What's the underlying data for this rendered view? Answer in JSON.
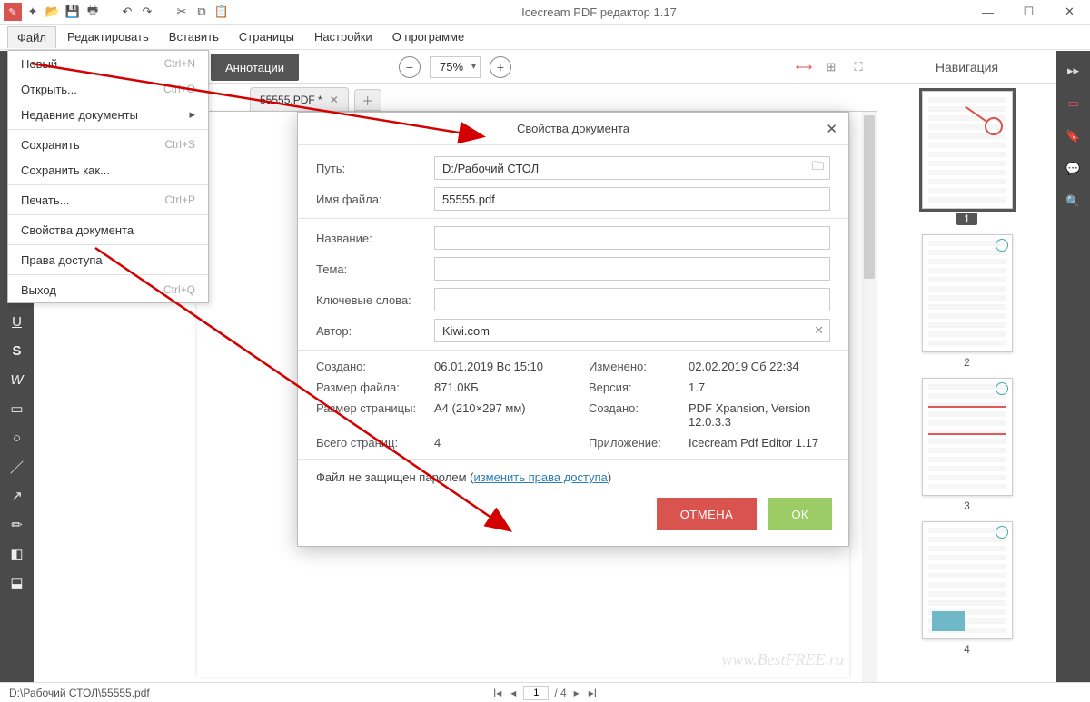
{
  "titlebar": {
    "title": "Icecream PDF редактор 1.17"
  },
  "menubar": {
    "items": [
      "Файл",
      "Редактировать",
      "Вставить",
      "Страницы",
      "Настройки",
      "О программе"
    ]
  },
  "file_menu": {
    "items": [
      {
        "label": "Новый",
        "shortcut": "Ctrl+N"
      },
      {
        "label": "Открыть...",
        "shortcut": "Ctrl+O"
      },
      {
        "label": "Недавние документы",
        "sub": true
      },
      {
        "sep": true
      },
      {
        "label": "Сохранить",
        "shortcut": "Ctrl+S"
      },
      {
        "label": "Сохранить как..."
      },
      {
        "sep": true
      },
      {
        "label": "Печать...",
        "shortcut": "Ctrl+P"
      },
      {
        "sep": true
      },
      {
        "label": "Свойства документа"
      },
      {
        "sep": true
      },
      {
        "label": "Права доступа"
      },
      {
        "sep": true
      },
      {
        "label": "Выход",
        "shortcut": "Ctrl+Q"
      }
    ]
  },
  "subtoolbar": {
    "annotations": "Аннотации",
    "zoom": "75%"
  },
  "tab": {
    "name": "55555.PDF *"
  },
  "dialog": {
    "title": "Свойства документа",
    "path_label": "Путь:",
    "path_value": "D:/Рабочий СТОЛ",
    "filename_label": "Имя файла:",
    "filename_value": "55555.pdf",
    "title_label": "Название:",
    "title_value": "",
    "subject_label": "Тема:",
    "subject_value": "",
    "keywords_label": "Ключевые слова:",
    "keywords_value": "",
    "author_label": "Автор:",
    "author_value": "Kiwi.com",
    "created_label": "Создано:",
    "created_value": "06.01.2019 Вс 15:10",
    "modified_label": "Изменено:",
    "modified_value": "02.02.2019 Сб 22:34",
    "size_label": "Размер файла:",
    "size_value": "871.0КБ",
    "version_label": "Версия:",
    "version_value": "1.7",
    "pagesize_label": "Размер страницы:",
    "pagesize_value": "A4 (210×297 мм)",
    "creator_label": "Создано:",
    "creator_value": "PDF Xpansion, Version 12.0.3.3",
    "pagecount_label": "Всего страниц:",
    "pagecount_value": "4",
    "app_label": "Приложение:",
    "app_value": "Icecream Pdf Editor 1.17",
    "protect_text": "Файл не защищен паролем (",
    "protect_link": "изменить права доступа",
    "protect_close": ")",
    "cancel": "ОТМЕНА",
    "ok": "ОК"
  },
  "nav": {
    "title": "Навигация",
    "pages": [
      "1",
      "2",
      "3",
      "4"
    ]
  },
  "statusbar": {
    "path": "D:\\Рабочий СТОЛ\\55555.pdf",
    "page": "1",
    "total": "/ 4"
  },
  "watermark": "www.BestFREE.ru",
  "right_rail_expand": "▸▸"
}
